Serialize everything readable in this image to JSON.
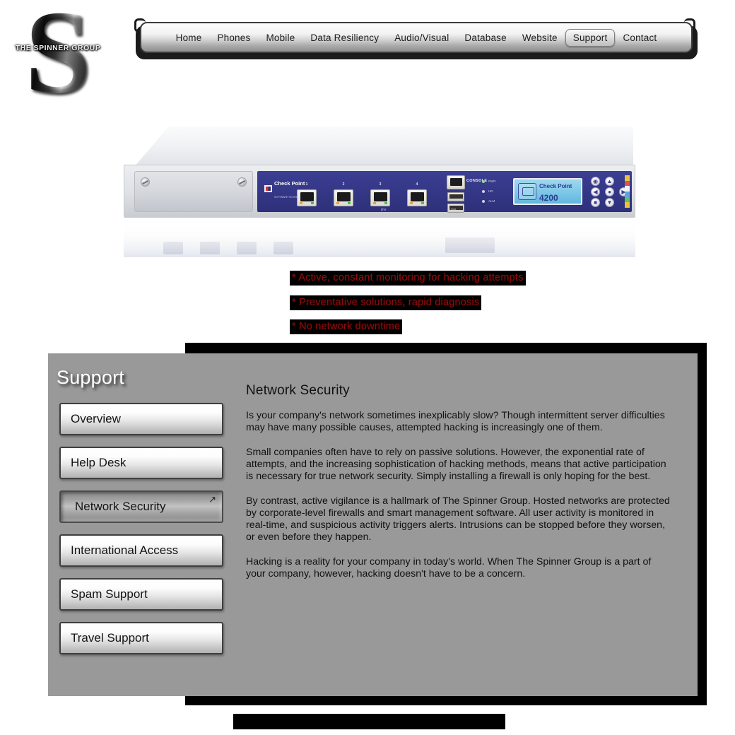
{
  "site": {
    "logo_letter": "S",
    "logo_words": "THE SPINNER GROUP"
  },
  "nav": {
    "items": [
      {
        "label": "Home",
        "active": false
      },
      {
        "label": "Phones",
        "active": false
      },
      {
        "label": "Mobile",
        "active": false
      },
      {
        "label": "Data Resiliency",
        "active": false
      },
      {
        "label": "Audio/Visual",
        "active": false
      },
      {
        "label": "Database",
        "active": false
      },
      {
        "label": "Website",
        "active": false
      },
      {
        "label": "Support",
        "active": true
      },
      {
        "label": "Contact",
        "active": false
      }
    ]
  },
  "hero": {
    "appliance": {
      "brand": "Check Point",
      "brand_sub": "SOFTWARE TECHNOLOGIES LTD",
      "lcd_brand": "Check Point",
      "lcd_model": "4200",
      "console_label": "CONSOLE",
      "usb_label": "USB",
      "dvi_label": "DVI",
      "port_numbers": [
        "1",
        "2",
        "3",
        "4"
      ],
      "status_labels": [
        "PWR",
        "HD",
        "ALM"
      ]
    },
    "bullets": [
      "* Active, constant monitoring for hacking attempts",
      "* Preventative solutions, rapid diagnosis",
      "* No network downtime"
    ],
    "bullet_color": "#8a0d0d",
    "bullet_bg": "#000000"
  },
  "panel": {
    "title": "Support",
    "bg_color": "#999999",
    "backdrop_color": "#000000"
  },
  "sidebar": {
    "items": [
      {
        "label": "Overview",
        "active": false
      },
      {
        "label": "Help Desk",
        "active": false
      },
      {
        "label": "Network Security",
        "active": true,
        "icon": "arrow-up-right-icon"
      },
      {
        "label": "International Access",
        "active": false
      },
      {
        "label": "Spam Support",
        "active": false
      },
      {
        "label": "Travel Support",
        "active": false
      }
    ]
  },
  "main": {
    "heading": "Network Security",
    "paragraphs": [
      "Is your company's network sometimes inexplicably slow? Though intermittent server difficulties may have many possible causes, attempted hacking is increasingly one of them.",
      "Small companies often have to rely on passive solutions. However, the exponential rate of attempts, and the increasing sophistication of hacking methods, means that active participation is necessary for true network security. Simply installing a firewall is only hoping for the best.",
      "By contrast, active vigilance is a hallmark of The Spinner Group. Hosted networks are protected by corporate-level firewalls and smart management software.  All user activity is monitored in real-time, and suspicious activity triggers alerts. Intrusions can be stopped before they worsen, or even before they happen.",
      "Hacking is a reality for your company in today's world. When The Spinner Group is a part of your company, however, hacking doesn't have to be a concern."
    ]
  },
  "footer": {
    "bar_color": "#000000"
  }
}
